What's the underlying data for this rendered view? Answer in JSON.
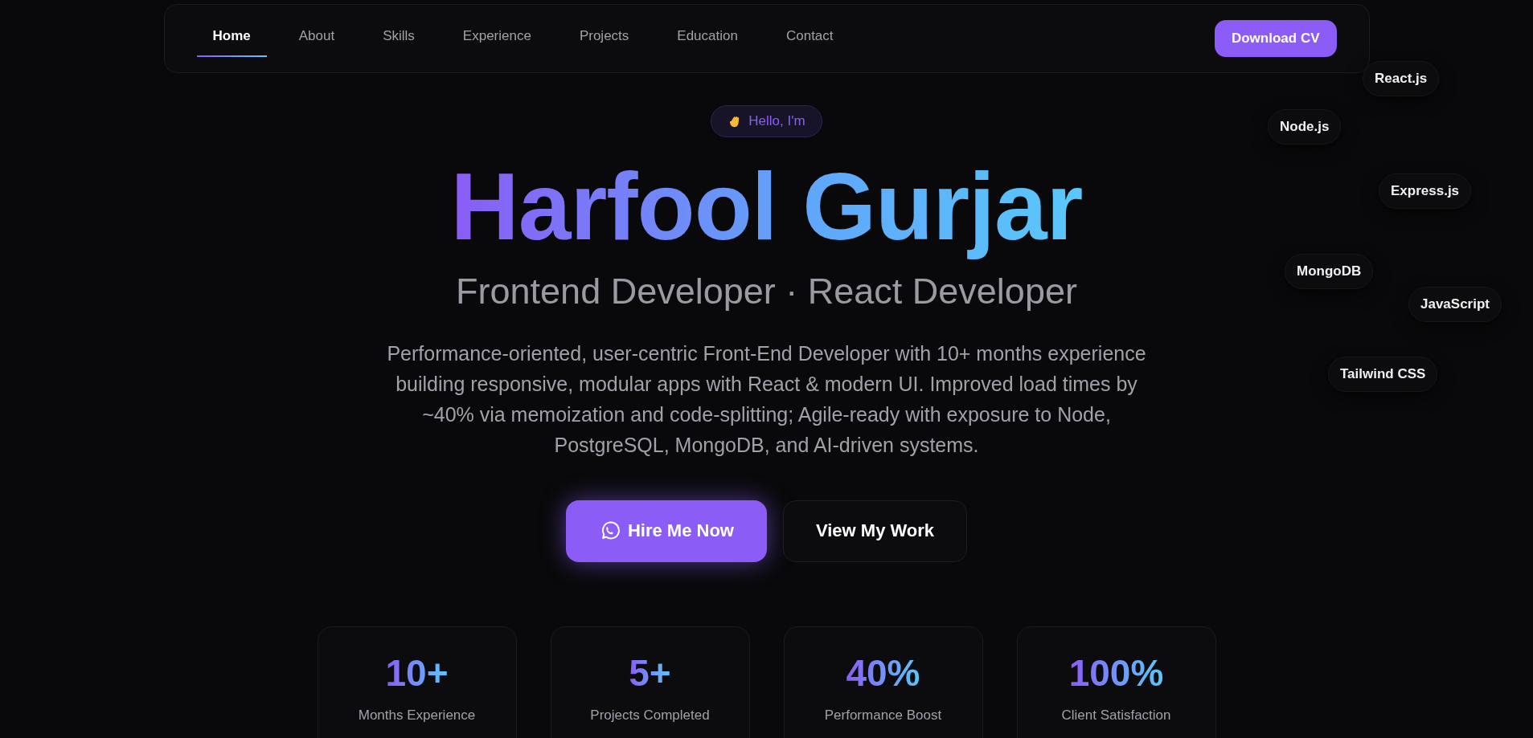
{
  "nav": {
    "items": [
      {
        "label": "Home",
        "selected": true
      },
      {
        "label": "About",
        "selected": false
      },
      {
        "label": "Skills",
        "selected": false
      },
      {
        "label": "Experience",
        "selected": false
      },
      {
        "label": "Projects",
        "selected": false
      },
      {
        "label": "Education",
        "selected": false
      },
      {
        "label": "Contact",
        "selected": false
      }
    ],
    "cta": "Download CV"
  },
  "tech_chips": [
    "React.js",
    "Node.js",
    "Express.js",
    "MongoDB",
    "JavaScript",
    "Tailwind CSS"
  ],
  "hero": {
    "badge": "Hello, I'm",
    "name": "Harfool Gurjar",
    "roles": "Frontend Developer · React Developer",
    "summary": "Performance-oriented, user-centric Front-End Developer with 10+ months experience building responsive, modular apps with React & modern UI. Improved load times by ~40% via memoization and code-splitting; Agile-ready with exposure to Node, PostgreSQL, MongoDB, and AI-driven systems.",
    "buttons": [
      {
        "label": "Hire Me Now",
        "kind": "primary"
      },
      {
        "label": "View My Work",
        "kind": "secondary"
      }
    ]
  },
  "stats": [
    {
      "value": "10+",
      "label": "Months Experience"
    },
    {
      "value": "5+",
      "label": "Projects Completed"
    },
    {
      "value": "40%",
      "label": "Performance Boost"
    },
    {
      "value": "100%",
      "label": "Client Satisfaction"
    }
  ]
}
